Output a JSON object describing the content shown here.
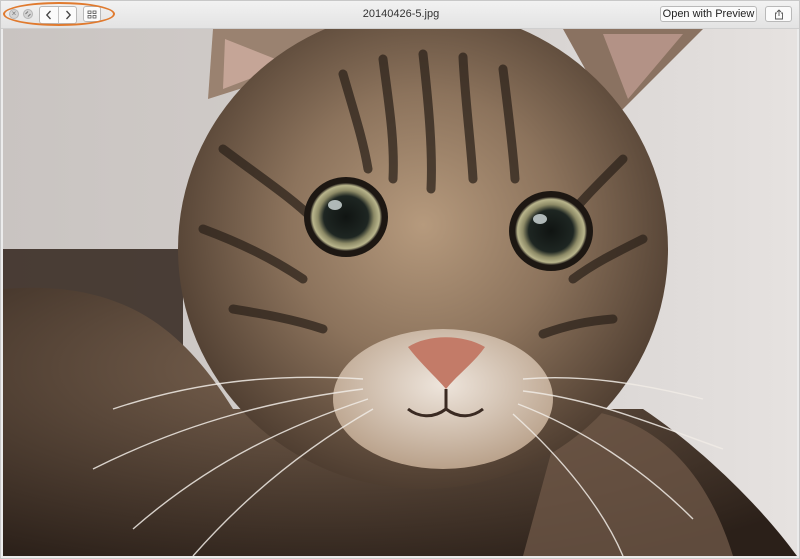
{
  "window": {
    "title": "20140426-5.jpg"
  },
  "toolbar": {
    "open_with_label": "Open with Preview",
    "close_glyph": "×",
    "icons": {
      "close": "close-icon",
      "fullscreen": "fullscreen-icon",
      "back": "chevron-left-icon",
      "forward": "chevron-right-icon",
      "index_sheet": "grid-icon",
      "share": "share-icon"
    },
    "highlight_color": "#e07a2e"
  },
  "photo": {
    "subject": "tabby-cat"
  }
}
